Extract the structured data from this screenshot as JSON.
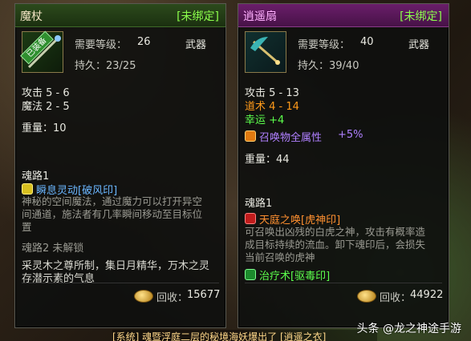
{
  "left": {
    "name": "魔杖",
    "bind_status": "[未绑定]",
    "ribbon": "已装备",
    "level_label": "需要等级：",
    "level_value": "26",
    "type": "武器",
    "durability": "持久：23/25",
    "attack": "攻击 5 - 6",
    "magic": "魔法 2 - 5",
    "weight": "重量：10",
    "soul_title": "魂路1",
    "skill_name": "瞬息灵动[破风印]",
    "skill_desc": [
      "神秘的空间魔法，通过魔力可以打开异空",
      "间通道，施法者有几率瞬间移动至目标位",
      "置"
    ],
    "soul2": "魂路2    未解锁",
    "lore": [
      "采灵木之尊所制，集日月精华，万木之灵",
      "存潜示素的气息"
    ],
    "recycle_label": "回收：",
    "recycle_value": "15677"
  },
  "right": {
    "name": "逍遥扇",
    "bind_status": "[未绑定]",
    "level_label": "需要等级：",
    "level_value": "40",
    "type": "武器",
    "durability": "持久：39/40",
    "attack": "攻击 5 - 13",
    "dao": "道术 4 - 14",
    "luck": "幸运 +4",
    "summon_attr": "召唤物全属性",
    "summon_value": "+5%",
    "weight": "重量：44",
    "soul_title": "魂路1",
    "skill1_name": "天庭之唤[虎神印]",
    "skill1_desc": [
      "可召唤出凶残的白虎之神，攻击有概率造",
      "成目标持续的流血。卸下魂印后，会损失",
      "当前召唤的虎神"
    ],
    "skill2_name": "治疗术[驱毒印]",
    "recycle_label": "回收：",
    "recycle_value": "44922"
  },
  "watermark": "头条 @龙之神途手游",
  "banner": "[系统] 魂暨浮庭二层的秘境海妖爆出了 [逍遥之衣]"
}
